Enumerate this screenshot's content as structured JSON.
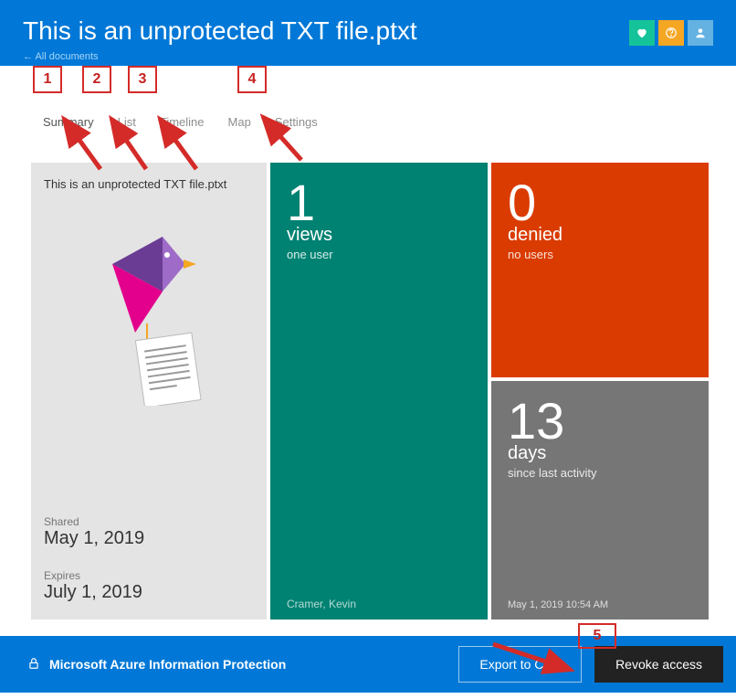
{
  "header": {
    "title": "This is an unprotected TXT file.ptxt",
    "back_link": "← All documents",
    "icons": {
      "heart": "heart-icon",
      "help": "help-icon",
      "user": "user-icon"
    }
  },
  "tabs": [
    {
      "label": "Summary"
    },
    {
      "label": "List"
    },
    {
      "label": "Timeline"
    },
    {
      "label": "Map"
    },
    {
      "label": "Settings"
    }
  ],
  "annotations": {
    "n1": "1",
    "n2": "2",
    "n3": "3",
    "n4": "4",
    "n5": "5"
  },
  "doc_card": {
    "title": "This is an unprotected TXT file.ptxt",
    "shared_label": "Shared",
    "shared_value": "May 1, 2019",
    "expires_label": "Expires",
    "expires_value": "July 1, 2019"
  },
  "views_tile": {
    "number": "1",
    "label": "views",
    "sub": "one user",
    "footer": "Cramer, Kevin"
  },
  "denied_tile": {
    "number": "0",
    "label": "denied",
    "sub": "no users"
  },
  "days_tile": {
    "number": "13",
    "label": "days",
    "sub": "since last activity",
    "footer": "May 1, 2019 10:54 AM"
  },
  "footer": {
    "brand": "Microsoft Azure Information Protection",
    "export_btn": "Export to CSV",
    "revoke_btn": "Revoke access"
  }
}
